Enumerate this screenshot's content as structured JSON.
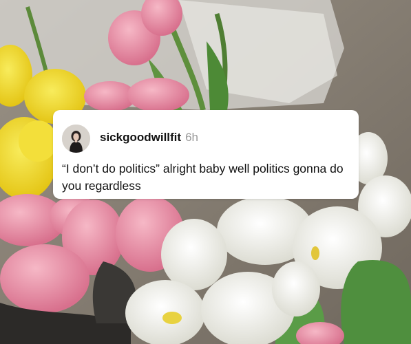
{
  "post": {
    "username": "sickgoodwillfit",
    "time": "6h",
    "text": "“I don’t do politics” alright baby well politics gonna do you regardless"
  },
  "icons": {
    "avatar": "profile-photo"
  },
  "colors": {
    "card_background": "#ffffff",
    "username": "#111111",
    "timestamp": "#9a9a9a",
    "text": "#111111"
  }
}
